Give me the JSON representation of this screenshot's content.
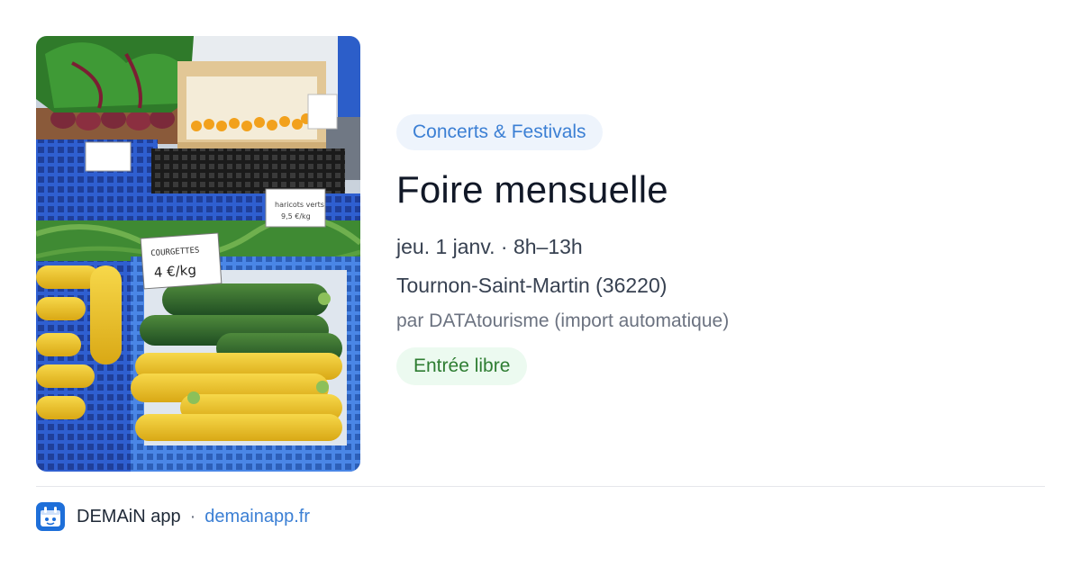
{
  "event": {
    "category": "Concerts & Festivals",
    "title": "Foire mensuelle",
    "datetime": "jeu. 1 janv. · 8h–13h",
    "location": "Tournon-Saint-Martin (36220)",
    "organizer": "par DATAtourisme (import automatique)",
    "price": "Entrée libre",
    "photo": {
      "description": "market-produce-photo",
      "sign_courgettes": "COURGETTES",
      "sign_price": "4 €/kg"
    }
  },
  "footer": {
    "app_name": "DEMAiN app",
    "separator": "·",
    "domain": "demainapp.fr",
    "icon": "demain-app-icon"
  },
  "colors": {
    "category_chip_bg": "#eef4fc",
    "category_chip_text": "#3b7fd4",
    "price_chip_bg": "#ecfaf0",
    "price_chip_text": "#2e7d32",
    "link": "#3b7fd4",
    "title": "#111827"
  }
}
